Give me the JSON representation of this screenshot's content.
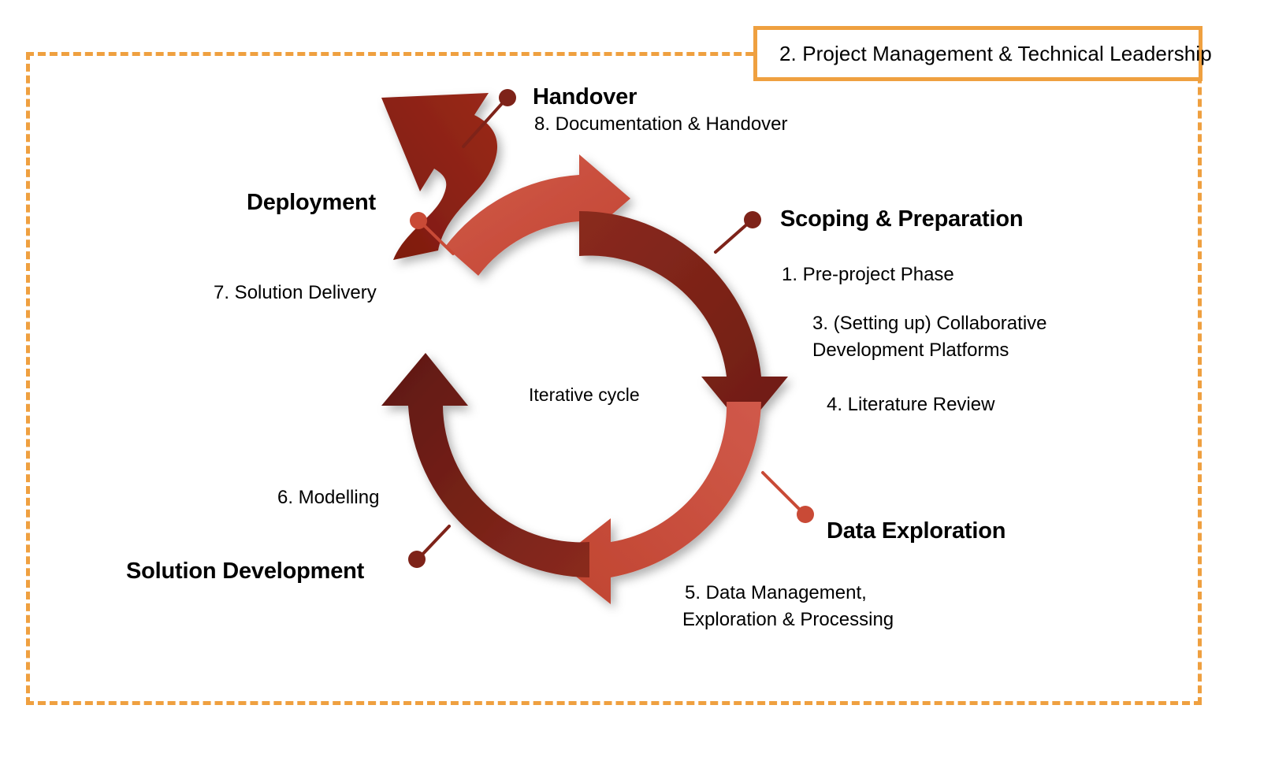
{
  "diagram": {
    "title_text": "Iterative cycle",
    "governance_callout": {
      "label": "2. Project Management & Technical Leadership",
      "border_color": "#EFA040"
    },
    "colors": {
      "arc_light": "#C94A36",
      "arc_dark": "#7E2319",
      "exit_arrow": "#8C1E12",
      "connector_light": "#C94A36",
      "connector_dark": "#7E2319",
      "frame_dashed": "#EFA040",
      "text": "#000000"
    },
    "phases": [
      {
        "id": "scoping",
        "title": "Scoping & Preparation",
        "steps": [
          "1. Pre-project Phase",
          "3. (Setting up) Collaborative",
          "Development Platforms",
          "4. Literature Review"
        ]
      },
      {
        "id": "data-exploration",
        "title": "Data Exploration",
        "steps": [
          "5. Data Management,",
          "Exploration & Processing"
        ]
      },
      {
        "id": "solution-development",
        "title": "Solution Development",
        "steps": [
          "6. Modelling"
        ]
      },
      {
        "id": "deployment",
        "title": "Deployment",
        "steps": [
          "7. Solution Delivery"
        ]
      },
      {
        "id": "handover",
        "title": "Handover",
        "steps": [
          "8. Documentation & Handover"
        ]
      }
    ]
  }
}
